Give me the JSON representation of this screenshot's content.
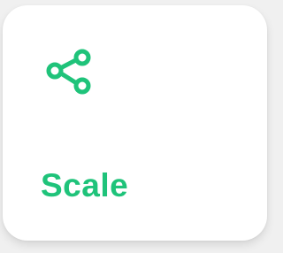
{
  "card": {
    "title": "Scale",
    "icon": "share-icon",
    "accent_color": "#1fc37a",
    "background_color": "#ffffff"
  }
}
